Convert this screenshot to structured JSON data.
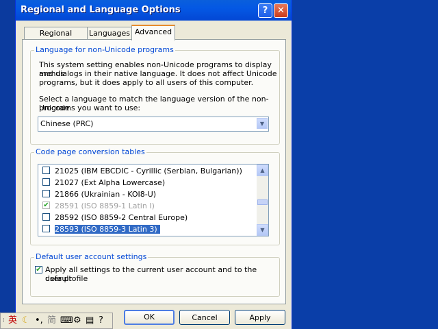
{
  "window": {
    "title": "Regional and Language Options",
    "help_icon": "?",
    "close_icon": "✕"
  },
  "tabs": [
    {
      "label": "Regional Options",
      "active": false
    },
    {
      "label": "Languages",
      "active": false
    },
    {
      "label": "Advanced",
      "active": true
    }
  ],
  "non_unicode": {
    "group_label": "Language for non-Unicode programs",
    "desc1": "This system setting enables non-Unicode programs to display menus",
    "desc2": "and dialogs in their native language. It does not affect Unicode",
    "desc3": "programs, but it does apply to all users of this computer.",
    "select1": "Select a language to match the language version of the non-Unicode",
    "select2": "programs you want to use:",
    "selected_language": "Chinese (PRC)"
  },
  "code_page": {
    "group_label": "Code page conversion tables",
    "items": [
      {
        "label": "21025 (IBM EBCDIC - Cyrillic (Serbian, Bulgarian))",
        "checked": false,
        "disabled": false,
        "selected": false
      },
      {
        "label": "21027 (Ext Alpha Lowercase)",
        "checked": false,
        "disabled": false,
        "selected": false
      },
      {
        "label": "21866 (Ukrainian - KOI8-U)",
        "checked": false,
        "disabled": false,
        "selected": false
      },
      {
        "label": "28591 (ISO 8859-1 Latin I)",
        "checked": true,
        "disabled": true,
        "selected": false
      },
      {
        "label": "28592 (ISO 8859-2 Central Europe)",
        "checked": false,
        "disabled": false,
        "selected": false
      },
      {
        "label": "28593 (ISO 8859-3 Latin 3)",
        "checked": false,
        "disabled": false,
        "selected": true
      }
    ]
  },
  "default_user": {
    "group_label": "Default user account settings",
    "line1": "Apply all settings to the current user account and to the default",
    "line2": "user profile",
    "checked": true
  },
  "buttons": {
    "ok": "OK",
    "cancel": "Cancel",
    "apply": "Apply"
  },
  "langbar": {
    "lang": "英",
    "mode": "简"
  },
  "colors": {
    "title_bar": "#0458e4",
    "selection": "#316ac5",
    "group_label": "#0046d5",
    "desktop": "#0b3a9e"
  }
}
